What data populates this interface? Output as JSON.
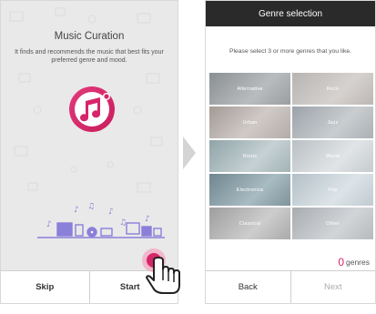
{
  "curation_screen": {
    "title": "Music Curation",
    "description": "It finds and recommends the music that best fits your preferred genre and mood.",
    "skip_label": "Skip",
    "start_label": "Start",
    "logo_icon": "music-note-logo-icon"
  },
  "genre_screen": {
    "header": "Genre selection",
    "instruction": "Please select 3 or more genres that you like.",
    "genres": [
      "Alternative",
      "Rock",
      "Urban",
      "Jazz",
      "Roots",
      "World",
      "Electronica",
      "Pop",
      "Classical",
      "Other"
    ],
    "selected_count": "0",
    "count_suffix": "genres",
    "back_label": "Back",
    "next_label": "Next"
  },
  "colors": {
    "accent": "#d6256b",
    "header_bg": "#2a2a2a"
  }
}
